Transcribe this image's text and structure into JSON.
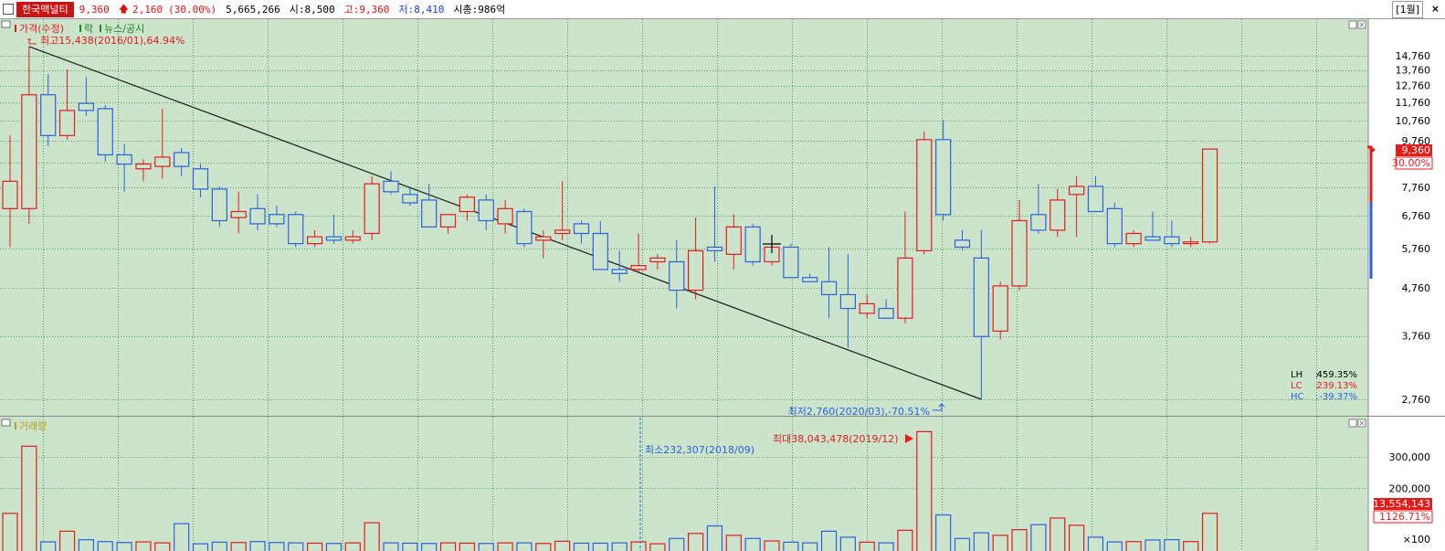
{
  "header": {
    "name": "한국맥널티",
    "price": "9,360",
    "arrow": "🡅",
    "change": "2,160",
    "rate": "(30.00%)",
    "volume": "5,665,266",
    "open": "시:8,500",
    "high": "고:9,360",
    "low": "저:8,410",
    "cap": "시총:986억",
    "period": "[1월]",
    "close": "×"
  },
  "price_panel": {
    "legend": [
      "가격(수정)",
      "락",
      "뉴스/공시"
    ],
    "max_note": "최고15,438(2016/01),64.94%",
    "min_note": "최저2,760(2020/03),-70.51%",
    "price_tag": "9,360",
    "rate_tag": "30.00%",
    "stats": [
      {
        "k": "LH",
        "v": "459.35%"
      },
      {
        "k": "LC",
        "v": "239.13%"
      },
      {
        "k": "HC",
        "v": "-39.37%"
      }
    ]
  },
  "volume_panel": {
    "legend": "거래량",
    "min_note": "최소232,307(2018/09)",
    "max_note": "최대38,043,478(2019/12)",
    "vol_tag": "13,554,143",
    "rate_tag": "1126.71%",
    "unit": "×100"
  },
  "colors": {
    "bg": "#cce3cc",
    "up": "#e41c1c",
    "down": "#2a62dc",
    "grid": "#2e8b2e",
    "trend": "#1a1a1a",
    "axis_bg": "#ffffff"
  },
  "chart_data": [
    {
      "type": "candlestick",
      "scale": "log",
      "y_ticks": [
        14760,
        13760,
        12760,
        11760,
        10760,
        9760,
        8760,
        7760,
        6760,
        5760,
        4760,
        3760,
        2760
      ],
      "y_tick_labels": [
        "14,760",
        "13,760",
        "12,760",
        "11,760",
        "10,760",
        "9,760",
        "8,760",
        "7,760",
        "6,760",
        "5,760",
        "4,760",
        "3,760",
        "2,760"
      ],
      "ohlc": [
        [
          7000,
          10000,
          5800,
          8000
        ],
        [
          7000,
          15438,
          6500,
          12200
        ],
        [
          12200,
          13500,
          9500,
          10000
        ],
        [
          10000,
          13800,
          9800,
          11300
        ],
        [
          11700,
          13300,
          11000,
          11300
        ],
        [
          11400,
          11600,
          8800,
          9100
        ],
        [
          9100,
          9600,
          7600,
          8700
        ],
        [
          8500,
          8900,
          8000,
          8700
        ],
        [
          8600,
          11400,
          8100,
          9000
        ],
        [
          9200,
          9400,
          8200,
          8600
        ],
        [
          8500,
          8700,
          7400,
          7700
        ],
        [
          7700,
          7800,
          6400,
          6600
        ],
        [
          6700,
          7600,
          6200,
          6900
        ],
        [
          7000,
          7500,
          6300,
          6500
        ],
        [
          6800,
          7100,
          6400,
          6500
        ],
        [
          6800,
          6900,
          5800,
          5900
        ],
        [
          5900,
          6300,
          5800,
          6100
        ],
        [
          6100,
          6800,
          5900,
          6000
        ],
        [
          6000,
          6300,
          5900,
          6100
        ],
        [
          6200,
          8200,
          6000,
          7900
        ],
        [
          8000,
          8400,
          7500,
          7600
        ],
        [
          7500,
          7800,
          7100,
          7200
        ],
        [
          7300,
          7900,
          6400,
          6400
        ],
        [
          6400,
          6700,
          6200,
          6800
        ],
        [
          6900,
          7500,
          6600,
          7400
        ],
        [
          7300,
          7500,
          6300,
          6600
        ],
        [
          6500,
          7300,
          6200,
          7000
        ],
        [
          6900,
          7000,
          5800,
          5900
        ],
        [
          6000,
          6300,
          5500,
          6100
        ],
        [
          6200,
          8000,
          6000,
          6300
        ],
        [
          6500,
          6600,
          5900,
          6200
        ],
        [
          6200,
          6600,
          5200,
          5200
        ],
        [
          5200,
          5700,
          4900,
          5100
        ],
        [
          5200,
          6200,
          5100,
          5300
        ],
        [
          5400,
          5600,
          5200,
          5500
        ],
        [
          5400,
          6000,
          4300,
          4700
        ],
        [
          4700,
          6700,
          4500,
          5700
        ],
        [
          5800,
          7800,
          5400,
          5700
        ],
        [
          5600,
          6800,
          5200,
          6400
        ],
        [
          6400,
          6500,
          5300,
          5400
        ],
        [
          5400,
          6100,
          5300,
          5800
        ],
        [
          5800,
          5900,
          5000,
          5000
        ],
        [
          5000,
          5100,
          4900,
          4900
        ],
        [
          4900,
          5800,
          4100,
          4600
        ],
        [
          4600,
          5600,
          3550,
          4300
        ],
        [
          4200,
          4600,
          4100,
          4400
        ],
        [
          4300,
          4500,
          4100,
          4100
        ],
        [
          4100,
          6900,
          4000,
          5500
        ],
        [
          5700,
          10200,
          5600,
          9800
        ],
        [
          9800,
          10800,
          6600,
          6800
        ],
        [
          6000,
          6300,
          5700,
          5800
        ],
        [
          5500,
          6300,
          2760,
          3750
        ],
        [
          3850,
          4900,
          3700,
          4800
        ],
        [
          4800,
          7300,
          4700,
          6600
        ],
        [
          6800,
          7900,
          6200,
          6300
        ],
        [
          6300,
          7700,
          6100,
          7300
        ],
        [
          7500,
          8200,
          6100,
          7800
        ],
        [
          7800,
          8200,
          6900,
          6900
        ],
        [
          7000,
          7200,
          5800,
          5900
        ],
        [
          5900,
          6300,
          5800,
          6200
        ],
        [
          6100,
          6900,
          6000,
          6000
        ],
        [
          6100,
          6600,
          5800,
          5900
        ],
        [
          5900,
          6100,
          5800,
          5950
        ],
        [
          5950,
          9360,
          5900,
          9360
        ]
      ],
      "trendline": {
        "from_index": 1,
        "from": 15438,
        "to_index": 51,
        "to": 2760
      }
    },
    {
      "type": "bar",
      "y_ticks": [
        300000,
        200000
      ],
      "y_tick_labels": [
        "300,000",
        "200,000"
      ],
      "values": [
        120000,
        334000,
        29000,
        63000,
        36000,
        30000,
        27000,
        29000,
        26000,
        87000,
        23000,
        28000,
        27000,
        30000,
        27000,
        26000,
        25000,
        24000,
        26000,
        90000,
        26000,
        25000,
        24000,
        26000,
        25000,
        24000,
        26000,
        26000,
        24000,
        31000,
        25000,
        25000,
        26000,
        29000,
        23000,
        40000,
        56000,
        80000,
        50000,
        40000,
        32000,
        28000,
        26000,
        63000,
        44000,
        28000,
        26000,
        66000,
        380430,
        115000,
        40000,
        58000,
        50000,
        68000,
        84000,
        105000,
        82000,
        44000,
        29000,
        30000,
        35000,
        36000,
        30000,
        120000
      ]
    }
  ]
}
